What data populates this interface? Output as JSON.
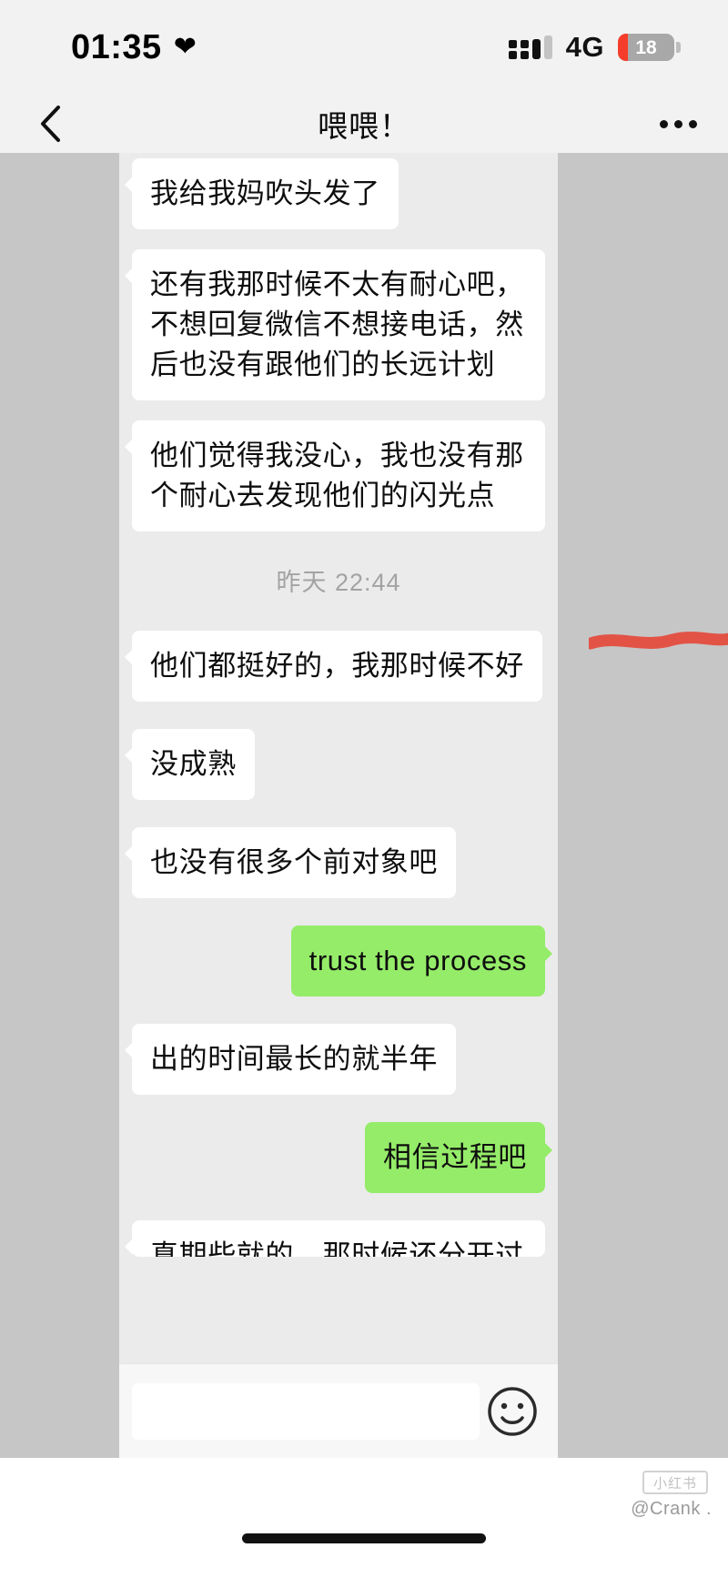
{
  "status_bar": {
    "time": "01:35",
    "heart_icon": "heart-icon",
    "signal_icon": "signal-dots-icon",
    "network": "4G",
    "battery_level": "18",
    "battery_percent": 18,
    "battery_color": "#f63d2b"
  },
  "nav_bar": {
    "back_icon": "chevron-left-icon",
    "title": "喂喂！",
    "more_icon": "more-horizontal-icon"
  },
  "chat": {
    "timestamp": "昨天 22:44",
    "bubble_in_color": "#ffffff",
    "bubble_out_color": "#95ec69",
    "messages": [
      {
        "side": "in",
        "text": "我给我妈吹头发了",
        "wide": false
      },
      {
        "side": "in",
        "text": "还有我那时候不太有耐心吧，不想回复微信不想接电话，然后也没有跟他们的长远计划",
        "wide": true
      },
      {
        "side": "in",
        "text": "他们觉得我没心，我也没有那个耐心去发现他们的闪光点",
        "wide": true
      },
      {
        "side": "in",
        "text": "他们都挺好的，我那时候不好",
        "wide": false
      },
      {
        "side": "in",
        "text": "没成熟",
        "wide": false
      },
      {
        "side": "in",
        "text": "也没有很多个前对象吧",
        "wide": false
      },
      {
        "side": "out",
        "text": "trust the process",
        "wide": false
      },
      {
        "side": "in",
        "text": "出的时间最长的就半年",
        "wide": false
      },
      {
        "side": "out",
        "text": "相信过程吧",
        "wide": false
      },
      {
        "side": "in",
        "text": "真期些就的，那时候还分开过好",
        "wide": true
      }
    ]
  },
  "input_bar": {
    "text_value": "",
    "placeholder": "",
    "emoji_icon": "smiley-face-icon"
  },
  "footer": {
    "watermark": "@Crank .",
    "logo_text": "小红书",
    "home_indicator": "home-indicator"
  }
}
